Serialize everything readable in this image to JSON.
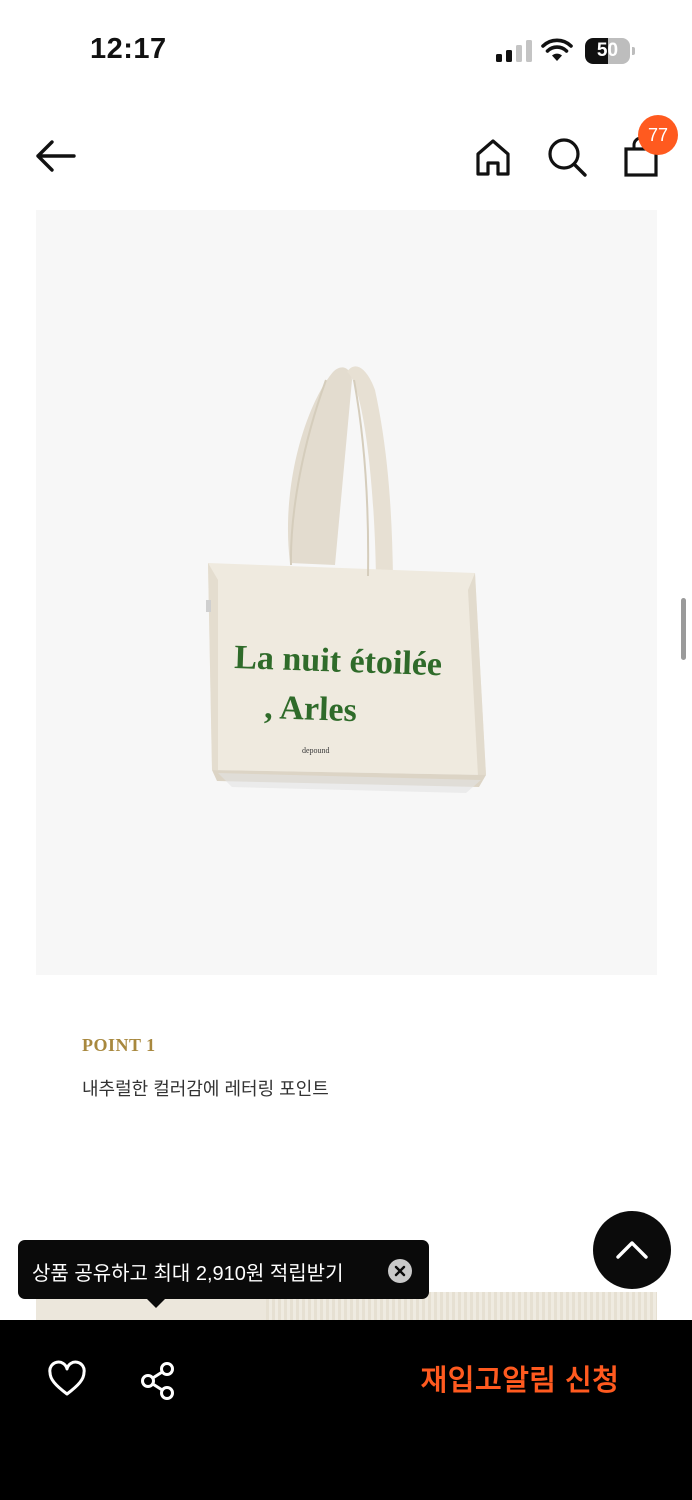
{
  "status_bar": {
    "time": "12:17",
    "battery": {
      "label": "50",
      "level": 0.5
    }
  },
  "nav": {
    "icons": [
      "back-arrow-icon",
      "home-icon",
      "search-icon",
      "shopping-bag-icon"
    ],
    "cart_count": "77"
  },
  "product": {
    "image_text": {
      "line1": "La nuit étoilée",
      "line2": ", Arles",
      "brand": "depound"
    },
    "point": {
      "title": "POINT 1",
      "description": "내추럴한 컬러감에 레터링 포인트"
    }
  },
  "tooltip": {
    "text": "상품 공유하고 최대 2,910원 적립받기"
  },
  "bottom_bar": {
    "restock_label": "재입고알림 신청",
    "icons": [
      "heart-icon",
      "share-icon"
    ]
  },
  "colors": {
    "accent": "#ff5a1f",
    "point_title": "#a8883e",
    "bag_lettering": "#2f6b2a",
    "bag_canvas": "#efeadf"
  }
}
